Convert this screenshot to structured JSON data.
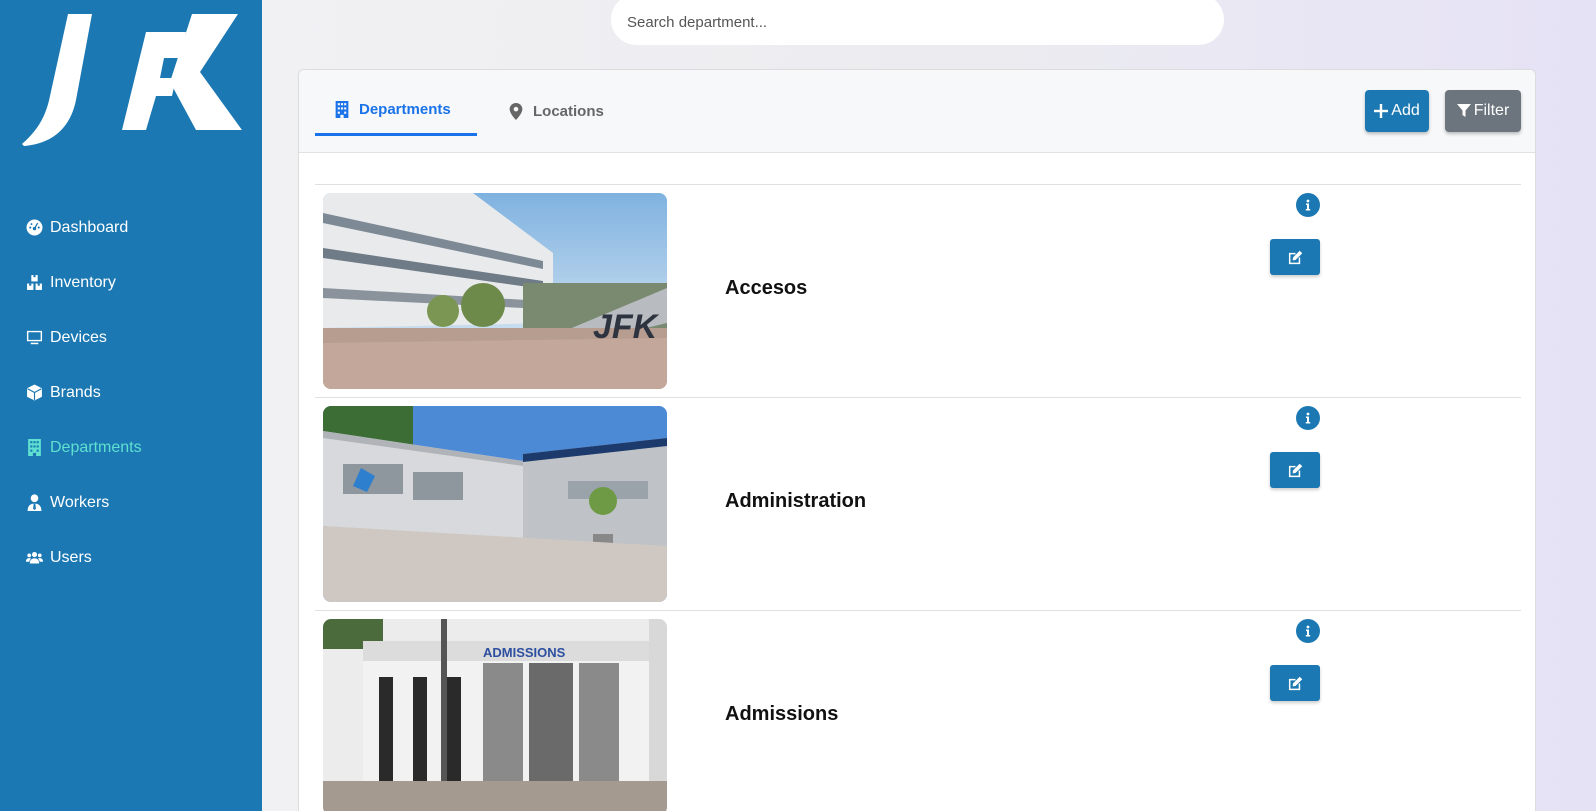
{
  "sidebar": {
    "logo_alt": "JFK",
    "items": [
      {
        "label": "Dashboard",
        "icon": "dashboard-icon"
      },
      {
        "label": "Inventory",
        "icon": "boxes-icon"
      },
      {
        "label": "Devices",
        "icon": "desktop-icon"
      },
      {
        "label": "Brands",
        "icon": "cube-icon"
      },
      {
        "label": "Departments",
        "icon": "building-icon",
        "active": true
      },
      {
        "label": "Workers",
        "icon": "user-tie-icon"
      },
      {
        "label": "Users",
        "icon": "users-icon"
      }
    ],
    "active_color": "#5fe0d0",
    "background": "#1b78b2"
  },
  "search": {
    "placeholder": "Search department..."
  },
  "tabs": [
    {
      "label": "Departments",
      "icon": "building-icon",
      "active": true
    },
    {
      "label": "Locations",
      "icon": "map-marker-icon"
    }
  ],
  "toolbar": {
    "add_label": "Add",
    "filter_label": "Filter"
  },
  "departments": [
    {
      "name": "Accesos"
    },
    {
      "name": "Administration"
    },
    {
      "name": "Admissions",
      "sign_text": "ADMISSIONS"
    }
  ],
  "colors": {
    "primary": "#1b78b2",
    "tab_active": "#1a73e8",
    "filter": "#6c757d"
  }
}
